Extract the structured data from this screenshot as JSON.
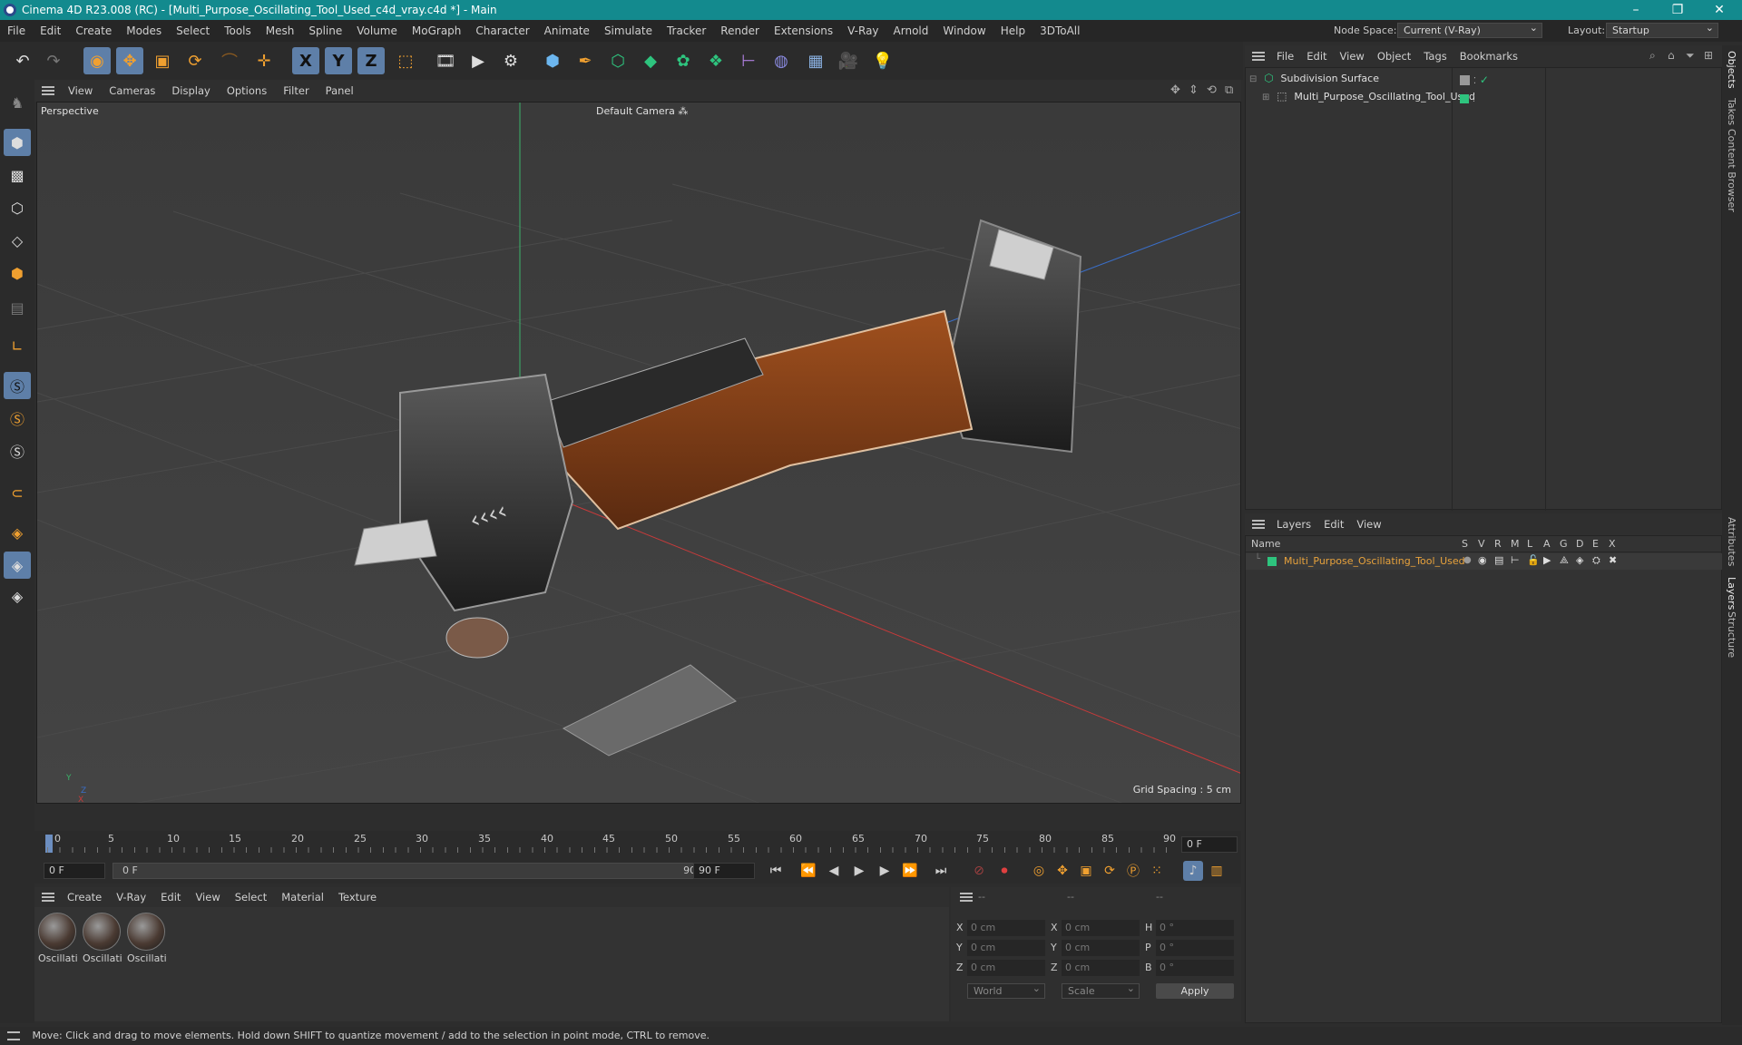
{
  "window": {
    "title": "Cinema 4D R23.008 (RC) - [Multi_Purpose_Oscillating_Tool_Used_c4d_vray.c4d *] - Main",
    "controls": [
      "–",
      "❐",
      "✕"
    ]
  },
  "menubar": {
    "items": [
      "File",
      "Edit",
      "Create",
      "Modes",
      "Select",
      "Tools",
      "Mesh",
      "Spline",
      "Volume",
      "MoGraph",
      "Character",
      "Animate",
      "Simulate",
      "Tracker",
      "Render",
      "Extensions",
      "V-Ray",
      "Arnold",
      "Window",
      "Help",
      "3DToAll"
    ],
    "node_space_label": "Node Space:",
    "node_space_value": "Current (V-Ray)",
    "layout_label": "Layout:",
    "layout_value": "Startup"
  },
  "toolbar": {
    "axis_x": "X",
    "axis_y": "Y",
    "axis_z": "Z"
  },
  "viewport": {
    "menu": [
      "View",
      "Cameras",
      "Display",
      "Options",
      "Filter",
      "Panel"
    ],
    "view_name": "Perspective",
    "camera_name": "Default Camera",
    "grid_spacing": "Grid Spacing : 5 cm",
    "axis_labels": {
      "y": "Y",
      "z": "Z",
      "x": "X"
    }
  },
  "timeline": {
    "ticks": [
      "0",
      "5",
      "10",
      "15",
      "20",
      "25",
      "30",
      "35",
      "40",
      "45",
      "50",
      "55",
      "60",
      "65",
      "70",
      "75",
      "80",
      "85",
      "90"
    ],
    "current_frame": "0 F"
  },
  "transport": {
    "start_field": "0 F",
    "range_start": "0 F",
    "range_end": "90 F",
    "end_field": "90 F"
  },
  "materials": {
    "menu": [
      "Create",
      "V-Ray",
      "Edit",
      "View",
      "Select",
      "Material",
      "Texture"
    ],
    "items": [
      "Oscillatin",
      "Oscillatin",
      "Oscillatin"
    ]
  },
  "coordinates": {
    "headers": [
      "--",
      "--",
      "--"
    ],
    "rows": [
      {
        "a": "X",
        "av": "0 cm",
        "b": "X",
        "bv": "0 cm",
        "c": "H",
        "cv": "0 °"
      },
      {
        "a": "Y",
        "av": "0 cm",
        "b": "Y",
        "bv": "0 cm",
        "c": "P",
        "cv": "0 °"
      },
      {
        "a": "Z",
        "av": "0 cm",
        "b": "Z",
        "bv": "0 cm",
        "c": "B",
        "cv": "0 °"
      }
    ],
    "space_select": "World",
    "mode_select": "Scale",
    "apply_label": "Apply"
  },
  "objects": {
    "menu": [
      "File",
      "Edit",
      "View",
      "Object",
      "Tags",
      "Bookmarks"
    ],
    "tree": [
      {
        "name": "Subdivision Surface",
        "indent": 0
      },
      {
        "name": "Multi_Purpose_Oscillating_Tool_Used",
        "indent": 1
      }
    ]
  },
  "layers": {
    "menu": [
      "Layers",
      "Edit",
      "View"
    ],
    "name_header": "Name",
    "flag_headers": [
      "S",
      "V",
      "R",
      "M",
      "L",
      "A",
      "G",
      "D",
      "E",
      "X"
    ],
    "rows": [
      {
        "name": "Multi_Purpose_Oscillating_Tool_Used"
      }
    ]
  },
  "right_tabs": [
    "Objects",
    "Takes",
    "Content Browser",
    "Attributes",
    "Layers",
    "Structure"
  ],
  "status": {
    "text": "Move: Click and drag to move elements. Hold down SHIFT to quantize movement / add to the selection in point mode, CTRL to remove."
  },
  "colors": {
    "titlebar": "#138a8e",
    "selected_tool": "#5e7fa8",
    "layer_color": "#2ec47e",
    "layer_name": "#e8a23c"
  }
}
